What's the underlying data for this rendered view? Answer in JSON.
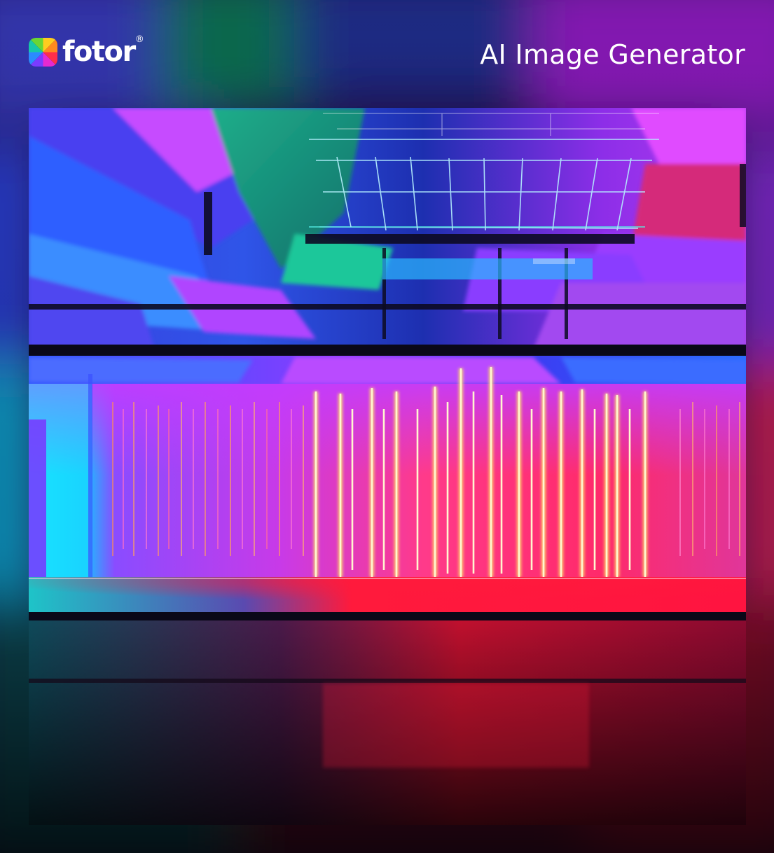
{
  "brand": {
    "name": "fotor",
    "registered_mark": "®",
    "logo_icon": "color-wheel-icon"
  },
  "header": {
    "title": "AI Image Generator"
  },
  "artwork": {
    "subject": "neon-lit interior hall with glowing vertical light strips",
    "colors": {
      "blue": "#2a4cff",
      "magenta": "#d83cff",
      "cyan": "#12d8ff",
      "red": "#ff1a3c",
      "green": "#1fae8a",
      "yellow": "#fff2a0"
    }
  }
}
